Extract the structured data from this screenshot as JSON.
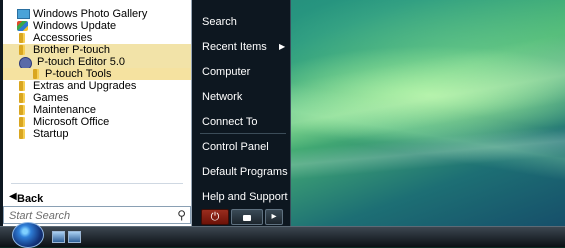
{
  "programs": [
    {
      "label": "Windows Photo Gallery",
      "icon": "photo-gallery-icon",
      "level": 0,
      "highlight": false
    },
    {
      "label": "Windows Update",
      "icon": "windows-update-icon",
      "level": 0,
      "highlight": false
    },
    {
      "label": "Accessories",
      "icon": "folder-icon",
      "level": 0,
      "highlight": false
    },
    {
      "label": "Brother P-touch",
      "icon": "folder-icon",
      "level": 0,
      "highlight": true
    },
    {
      "label": "P-touch Editor 5.0",
      "icon": "ptouch-editor-icon",
      "level": 1,
      "highlight": true
    },
    {
      "label": "P-touch Tools",
      "icon": "folder-icon",
      "level": 2,
      "highlight": true
    },
    {
      "label": "Extras and Upgrades",
      "icon": "folder-icon",
      "level": 0,
      "highlight": false
    },
    {
      "label": "Games",
      "icon": "folder-icon",
      "level": 0,
      "highlight": false
    },
    {
      "label": "Maintenance",
      "icon": "folder-icon",
      "level": 0,
      "highlight": false
    },
    {
      "label": "Microsoft Office",
      "icon": "folder-icon",
      "level": 0,
      "highlight": false
    },
    {
      "label": "Startup",
      "icon": "folder-icon",
      "level": 0,
      "highlight": false
    }
  ],
  "back_label": "Back",
  "search_placeholder": "Start Search",
  "right": {
    "search": "Search",
    "recent_items": "Recent Items",
    "computer": "Computer",
    "network": "Network",
    "connect_to": "Connect To",
    "control_panel": "Control Panel",
    "default_programs": "Default Programs",
    "help_and_support": "Help and Support"
  },
  "power_icons": {
    "power": "⏻",
    "lock": "🔒",
    "arrow": "▸"
  }
}
